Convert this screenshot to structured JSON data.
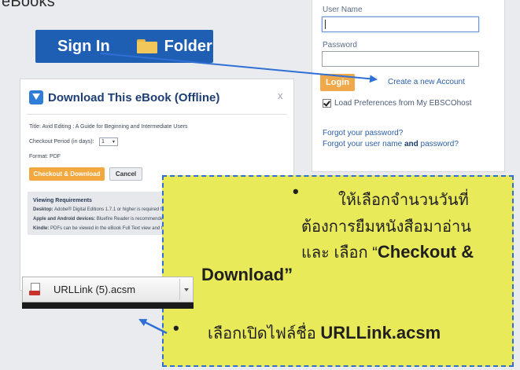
{
  "header": {
    "text": "eBooks"
  },
  "signbar": {
    "sign_in": "Sign In",
    "folder": "Folder"
  },
  "login": {
    "username_label": "User Name",
    "password_label": "Password",
    "login_button": "Login",
    "create_account": "Create a new Account",
    "load_prefs": "Load Preferences from My EBSCOhost",
    "load_prefs_checked": true,
    "forgot_password": "Forgot your password?",
    "forgot_user_prefix": "Forgot your user name",
    "forgot_user_and": "and",
    "forgot_user_suffix": "password?"
  },
  "dialog": {
    "title": "Download This eBook (Offline)",
    "close": "x",
    "title_line": "Title: Avid Editing : A Guide for Beginning and Intermediate Users",
    "checkout_label": "Checkout Period (in days):",
    "checkout_value": "1",
    "format": "Format: PDF",
    "checkout_button": "Checkout & Download",
    "cancel_button": "Cancel",
    "req_heading": "Viewing Requirements",
    "req_desktop_label": "Desktop:",
    "req_desktop_text": "Adobe® Digital Editions 1.7.1 or higher is required for offline viewing",
    "req_apple_label": "Apple and Android devices:",
    "req_apple_text": "Bluefire Reader is recommended",
    "req_kindle_label": "Kindle:",
    "req_kindle_text": "PDFs can be viewed in the eBook Full Text view and transferred using Send To Kindle"
  },
  "callout": {
    "bullet": "•",
    "line1": "ให้เลือกจำนวนวันที่",
    "line2": "ต้องการยืมหนังสือมาอ่าน",
    "line3_prefix": "และ เลือก “",
    "line3_bold": "Checkout &",
    "line4": "Download”",
    "line5_prefix": "เลือกเปิดไฟล์ชื่อ ",
    "line5_bold": "URLLink.acsm"
  },
  "download_bar": {
    "filename": "URLLink (5).acsm"
  },
  "colors": {
    "signbar": "#1f5fb3",
    "login_button": "#f0a94a",
    "checkout_button": "#f2a83f",
    "callout_bg": "#e9ea5a",
    "callout_border": "#2e6fd4"
  }
}
